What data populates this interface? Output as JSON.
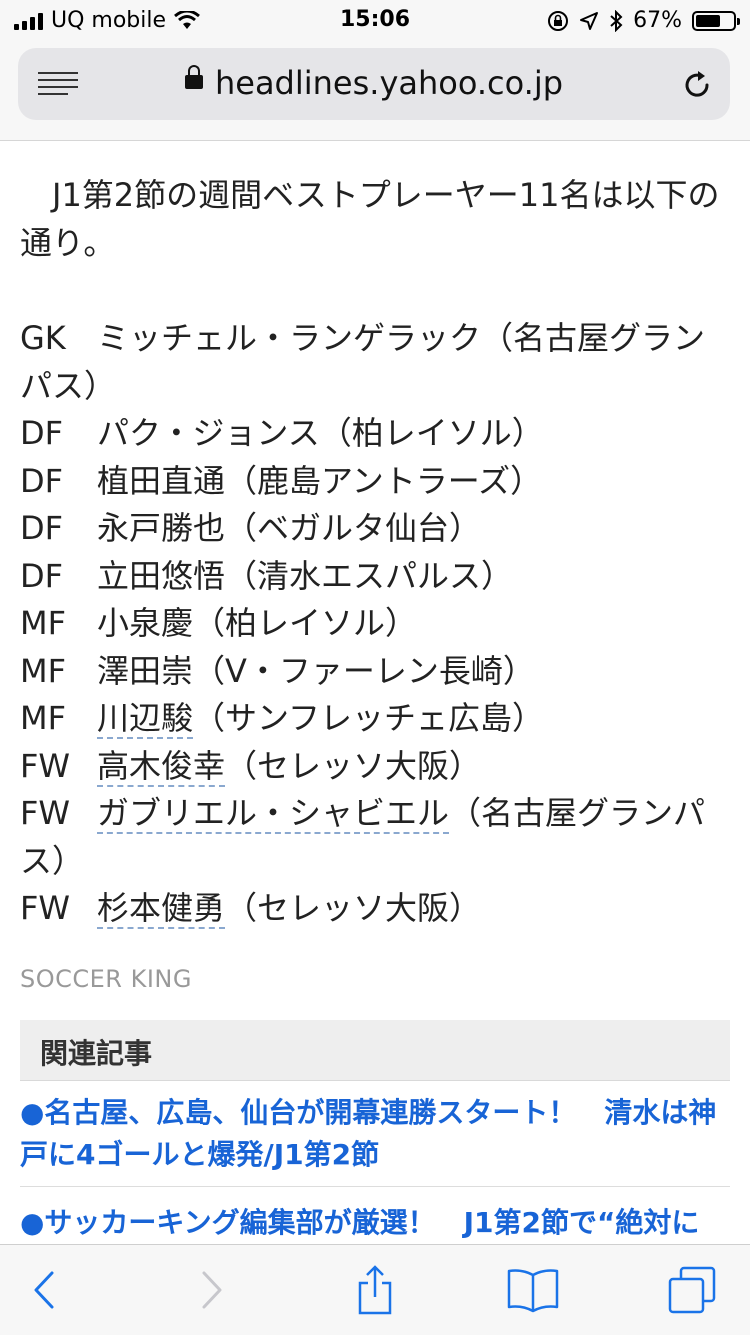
{
  "status_bar": {
    "carrier": "UQ mobile",
    "time": "15:06",
    "battery": "67%",
    "battery_level": 0.67
  },
  "browser": {
    "url": "headlines.yahoo.co.jp"
  },
  "article": {
    "intro_line1": "J1第2節の週間ベストプレーヤー11名は以下の",
    "intro_line2": "通り。",
    "players": [
      {
        "pos": "GK",
        "line1": "ミッチェル・ランゲラック（名古屋グラン",
        "line2": "パス）"
      },
      {
        "pos": "DF",
        "name": "パク・ジョンス（柏レイソル）"
      },
      {
        "pos": "DF",
        "name": "植田直通（鹿島アントラーズ）"
      },
      {
        "pos": "DF",
        "name": "永戸勝也（ベガルタ仙台）"
      },
      {
        "pos": "DF",
        "name": "立田悠悟（清水エスパルス）"
      },
      {
        "pos": "MF",
        "name": "小泉慶（柏レイソル）"
      },
      {
        "pos": "MF",
        "name": "澤田崇（V・ファーレン長崎）"
      },
      {
        "pos": "MF",
        "link": "川辺駿",
        "rest": "（サンフレッチェ広島）"
      },
      {
        "pos": "FW",
        "link": "高木俊幸",
        "rest": "（セレッソ大阪）"
      },
      {
        "pos": "FW",
        "link": "ガブリエル・シャビエル",
        "rest": "（名古屋グランパ",
        "line2": "ス）"
      },
      {
        "pos": "FW",
        "link": "杉本健勇",
        "rest": "（セレッソ大阪）"
      }
    ],
    "source": "SOCCER KING"
  },
  "related": {
    "heading": "関連記事",
    "item1_line1": "●名古屋、広島、仙台が開幕連勝スタート！　清水は神",
    "item1_line2": "戸に4ゴールと爆発/J1第2節",
    "item2_line1": "●サッカーキング編集部が厳選！　J1第2節で“絶対に"
  },
  "colors": {
    "link": "#1864d6",
    "toolbar_icon": "#1a73e8",
    "source_text": "#999999"
  }
}
